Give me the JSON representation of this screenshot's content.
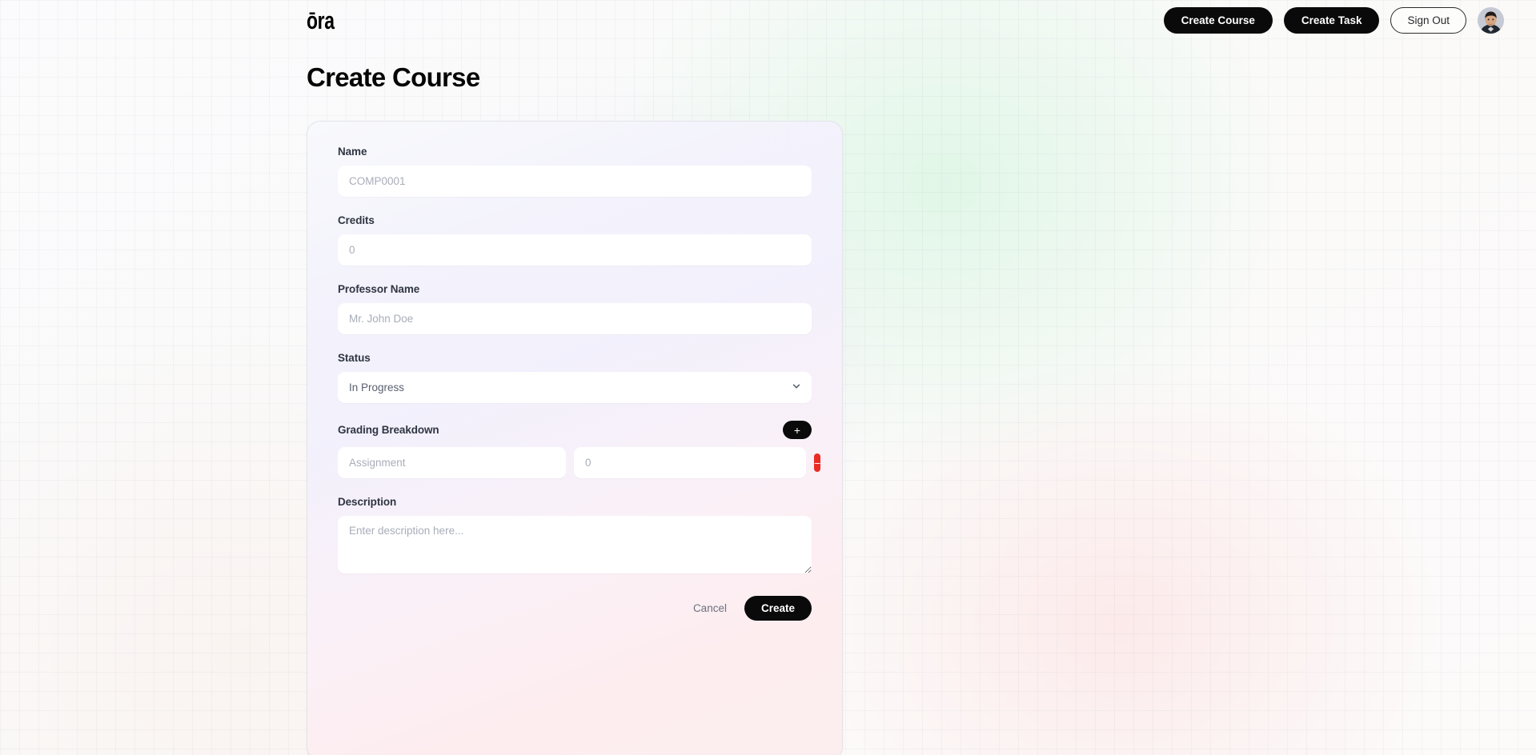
{
  "header": {
    "logo_text": "ōra",
    "create_course_label": "Create Course",
    "create_task_label": "Create Task",
    "sign_out_label": "Sign Out"
  },
  "page": {
    "title": "Create Course"
  },
  "form": {
    "name": {
      "label": "Name",
      "placeholder": "COMP0001",
      "value": ""
    },
    "credits": {
      "label": "Credits",
      "placeholder": "0",
      "value": ""
    },
    "professor": {
      "label": "Professor Name",
      "placeholder": "Mr. John Doe",
      "value": ""
    },
    "status": {
      "label": "Status",
      "selected": "In Progress"
    },
    "grading": {
      "label": "Grading Breakdown",
      "add_label": "+",
      "remove_label": "−",
      "rows": [
        {
          "name_placeholder": "Assignment",
          "weight_placeholder": "0",
          "name_value": "",
          "weight_value": ""
        }
      ]
    },
    "description": {
      "label": "Description",
      "placeholder": "Enter description here...",
      "value": ""
    }
  },
  "footer": {
    "cancel_label": "Cancel",
    "create_label": "Create"
  },
  "colors": {
    "accent_dark": "#0a0a0a",
    "danger": "#ec2b24",
    "label_text": "#2f3542",
    "placeholder": "#a8adb9"
  }
}
